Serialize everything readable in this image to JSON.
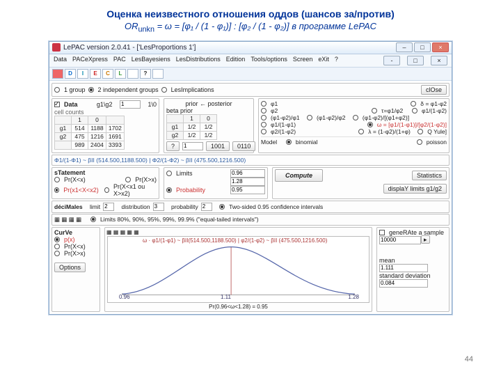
{
  "slide": {
    "title1": "Оценка неизвестного отношения оддов (шансов за/против)",
    "title2_html": "OR",
    "title2_sub": "unkn",
    "title2_rest": " = ω = [φ₁ / (1 - φ₁)] : [φ₂ / (1 - φ₂)]  в программе LePAC",
    "pagenum": "44"
  },
  "window": {
    "title": "LePAC version 2.0.41 - ['LesProportions 1']"
  },
  "menus": [
    "Data",
    "PACeXpress",
    "PAC",
    "LesBayesiens",
    "LesDistributions",
    "Edition",
    "Tools/options",
    "Screen",
    "eXit",
    "?"
  ],
  "toolbar_letters": [
    "⌂",
    "D",
    "I",
    "E",
    "C",
    "L",
    "",
    "",
    "",
    "?",
    "",
    "",
    "-",
    "□",
    "×"
  ],
  "mdi_buttons": [
    "-",
    "□",
    "×"
  ],
  "groups": {
    "g1": "1 group",
    "g2": "2 independent groups",
    "g3": "LesImplications",
    "close": "clOse"
  },
  "data_box": {
    "title": "Data",
    "head": [
      "g1\\g2",
      "1",
      "1\\0"
    ],
    "cell_counts": "cell counts",
    "g1": "g1",
    "g2": "g2",
    "r1": [
      "514",
      "1188",
      "1702"
    ],
    "r2": [
      "475",
      "1216",
      "1691"
    ],
    "tot": [
      "989",
      "2404",
      "3393"
    ]
  },
  "prior_box": {
    "title": "prior ← posterior",
    "beta": "beta prior",
    "one": "1",
    "zero": "0",
    "g1": "g1",
    "g2": "g2",
    "half": "1/2",
    "ten": "1/0",
    "qm": "?",
    "n1": "1001",
    "n2": "0110"
  },
  "params": {
    "phi1": "φ1",
    "phi2": "φ2",
    "dphi": "δ = φ1-φ2",
    "tau": "τ=φ1/φ2",
    "phi1c": "φ1/(1-φ2)",
    "ratio1": "(φ1-φ2)/φ1",
    "ratio2": "(φ1-φ2)/φ2",
    "complex": "(φ1-φ2)/[(φ1+φ2)]",
    "oddsphi1": "φ1/(1-φ1)",
    "omega": "ω = [φ1/(1-φ1)]/[φ2/(1-φ2)]",
    "oddsphi2": "φ2/(1-φ2)",
    "logit": "λ = (1-φ2)/(1+φ)",
    "Q": "Q Yule]"
  },
  "model": {
    "label": "Model",
    "binomial": "binomial",
    "poisson": "poisson"
  },
  "formula": "Φ1/(1-Φ1) ~ βII (514.500,1188.500) | Φ2/(1-Φ2) ~ βII (475.500,1216.500)",
  "statement": {
    "title": "sTatement",
    "o1": "Pr(X<x)",
    "o2": "Pr(X>x)",
    "o3": "Pr(x1<X<x2)",
    "o4": "Pr(X<x1 ou X>x2)"
  },
  "limits": {
    "Limits": "Limits",
    "Probability": "Probability",
    "v1": "0.96",
    "v2": "1.28",
    "v3": "0.95",
    "Compute": "Compute",
    "Statistics": "Statistics",
    "display": "displaY limits g1/g2"
  },
  "deci": {
    "label": "déciMales",
    "limit": "limit",
    "val1": "2",
    "dist": "distribution",
    "val2": "3",
    "prob": "probability",
    "val3": "2",
    "opt1": "Two-sided 0.95 confidence intervals",
    "opt2": "Limits 80%, 90%, 95%, 99%, 99.9% (\"equal-tailed intervals\")"
  },
  "curve_box": {
    "title": "CurVe",
    "p": "p(x)",
    "px1": "Pr(X<x)",
    "px2": "Pr(X>x)",
    "Options": "Options"
  },
  "gen": {
    "label": "geneRAte a sample",
    "val": "10000",
    "mean": "mean",
    "meanv": "1.111",
    "sd": "standard deviation",
    "sdv": "0.084"
  },
  "plot": {
    "top": "ω · φ1/(1-φ1) ~ βII(514.500,1188.500) | φ2/(1-φ2) ~ βII (475.500,1216.500)",
    "x1": "0.96",
    "xm": "1.11",
    "x2": "1.28",
    "bottom": "Pr(0.96<ω<1.28) = 0.95"
  }
}
